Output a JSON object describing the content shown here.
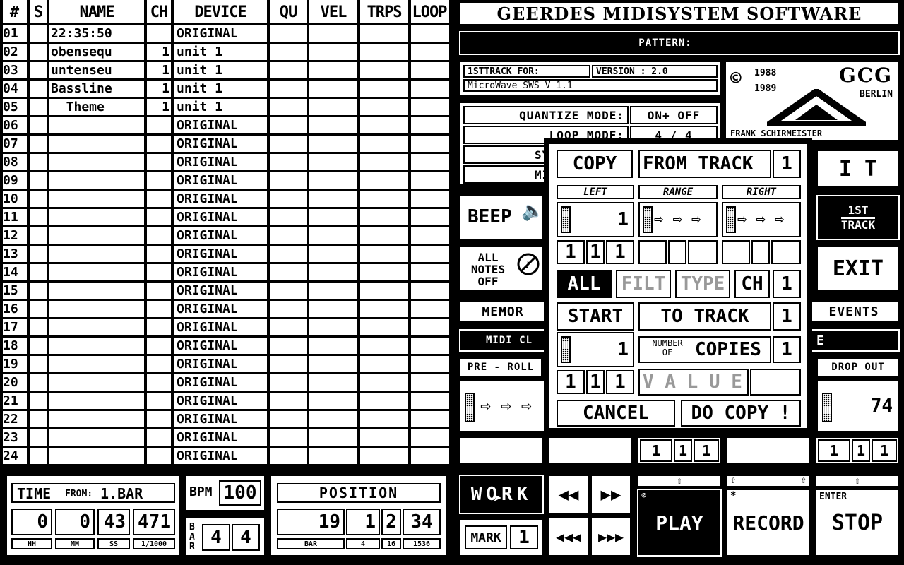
{
  "table": {
    "headers": [
      "#",
      "S",
      "NAME",
      "CH",
      "DEVICE",
      "QU",
      "VEL",
      "TRPS",
      "LOOP"
    ],
    "rows": [
      {
        "num": "01",
        "name": "22:35:50",
        "ch": "",
        "device": "ORIGINAL"
      },
      {
        "num": "02",
        "name": "obensequ",
        "ch": "1",
        "device": "unit 1"
      },
      {
        "num": "03",
        "name": "untenseu",
        "ch": "1",
        "device": "unit 1"
      },
      {
        "num": "04",
        "name": "Bassline",
        "ch": "1",
        "device": "unit 1"
      },
      {
        "num": "05",
        "name": "  Theme",
        "ch": "1",
        "device": "unit 1"
      },
      {
        "num": "06",
        "name": "",
        "ch": "",
        "device": "ORIGINAL"
      },
      {
        "num": "07",
        "name": "",
        "ch": "",
        "device": "ORIGINAL"
      },
      {
        "num": "08",
        "name": "",
        "ch": "",
        "device": "ORIGINAL"
      },
      {
        "num": "09",
        "name": "",
        "ch": "",
        "device": "ORIGINAL"
      },
      {
        "num": "10",
        "name": "",
        "ch": "",
        "device": "ORIGINAL"
      },
      {
        "num": "11",
        "name": "",
        "ch": "",
        "device": "ORIGINAL"
      },
      {
        "num": "12",
        "name": "",
        "ch": "",
        "device": "ORIGINAL"
      },
      {
        "num": "13",
        "name": "",
        "ch": "",
        "device": "ORIGINAL"
      },
      {
        "num": "14",
        "name": "",
        "ch": "",
        "device": "ORIGINAL"
      },
      {
        "num": "15",
        "name": "",
        "ch": "",
        "device": "ORIGINAL"
      },
      {
        "num": "16",
        "name": "",
        "ch": "",
        "device": "ORIGINAL"
      },
      {
        "num": "17",
        "name": "",
        "ch": "",
        "device": "ORIGINAL"
      },
      {
        "num": "18",
        "name": "",
        "ch": "",
        "device": "ORIGINAL"
      },
      {
        "num": "19",
        "name": "",
        "ch": "",
        "device": "ORIGINAL"
      },
      {
        "num": "20",
        "name": "",
        "ch": "",
        "device": "ORIGINAL"
      },
      {
        "num": "21",
        "name": "",
        "ch": "",
        "device": "ORIGINAL"
      },
      {
        "num": "22",
        "name": "",
        "ch": "",
        "device": "ORIGINAL"
      },
      {
        "num": "23",
        "name": "",
        "ch": "",
        "device": "ORIGINAL"
      },
      {
        "num": "24",
        "name": "",
        "ch": "",
        "device": "ORIGINAL"
      }
    ]
  },
  "app": {
    "title": "GEERDES MIDISYSTEM SOFTWARE",
    "pattern_label": "PATTERN:"
  },
  "info": {
    "track_for": "1STTRACK  FOR:",
    "version": "VERSION : 2.0",
    "device": "MicroWave SWS   V 1.1"
  },
  "logo": {
    "copyright": "©",
    "years": [
      "1988",
      "1989"
    ],
    "brand": "GCG",
    "city": "BERLIN",
    "author": "FRANK SCHIRMEISTER"
  },
  "modes": {
    "quantize_label": "QUANTIZE MODE:",
    "quantize_value": "ON+ OFF",
    "loop_label": "LOOP MODE:",
    "loop_value": "4 / 4",
    "sync_label": "SYN",
    "midi_label": "MID"
  },
  "buttons": {
    "beep": "BEEP",
    "all_notes_off": [
      "ALL",
      "NOTES",
      "OFF"
    ],
    "memory": "MEMOR",
    "midi_clock": "MIDI CL",
    "events": "EVENTS",
    "edit": "I T",
    "first_track": [
      "1ST",
      "TRACK"
    ],
    "exit": "EXIT",
    "pre_roll": "PRE - ROLL",
    "drop_out": "DROP OUT",
    "drop_out_value": "74",
    "e_label": "E",
    "work": "WORK",
    "mark": "MARK",
    "mark_value": "1",
    "play": "PLAY",
    "record": "RECORD",
    "stop": "STOP",
    "enter": "ENTER"
  },
  "bottom_row": {
    "group3": [
      "1",
      "1",
      "1"
    ],
    "group5": [
      "1",
      "1",
      "1"
    ]
  },
  "copy_dialog": {
    "copy": "COPY",
    "from_track": "FROM   TRACK",
    "from_track_value": "1",
    "left": "LEFT",
    "range": "RANGE",
    "right": "RIGHT",
    "left_value": "1",
    "left_pos": [
      "1",
      "1",
      "1"
    ],
    "all": "ALL",
    "filt": "FILT",
    "type": "TYPE",
    "ch": "CH",
    "ch_value": "1",
    "start": "START",
    "to_track": "TO   TRACK",
    "to_track_value": "1",
    "start_value": "1",
    "number_of": [
      "NUMBER",
      "OF"
    ],
    "copies": "COPIES",
    "copies_value": "1",
    "start_pos": [
      "1",
      "1",
      "1"
    ],
    "value": "V A L U E",
    "cancel": "CANCEL",
    "do_copy": "DO  COPY !"
  },
  "time": {
    "label": "TIME",
    "from": "FROM:",
    "from_value": "1.BAR",
    "values": [
      "0",
      "0",
      "43",
      "471"
    ],
    "units": [
      "HH",
      "MM",
      "SS",
      "1/1000"
    ]
  },
  "bpm": {
    "label": "BPM",
    "value": "100"
  },
  "bar": {
    "label": "BAR",
    "values": [
      "4",
      "4"
    ]
  },
  "position": {
    "label": "POSITION",
    "values": [
      "19",
      "1",
      "2",
      "34"
    ],
    "units": [
      "BAR",
      "4",
      "16",
      "1536"
    ]
  }
}
